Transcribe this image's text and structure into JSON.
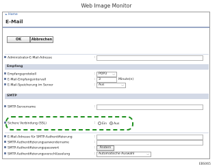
{
  "window": {
    "title": "Web Image Monitor"
  },
  "breadcrumb": {
    "arrow": "►",
    "home": "Home"
  },
  "page": {
    "title": "E-Mail"
  },
  "toolbar": {
    "ok_label": "OK",
    "cancel_label": "Abbrechen"
  },
  "fields": {
    "admin_email": {
      "label": "Administrator-E-Mail-Adresse",
      "value": ""
    },
    "reception_section": "Empfang",
    "protocol": {
      "label": "Empfangsprotokoll",
      "value": "POP3"
    },
    "interval": {
      "label": "E-Mail-Empfangsintervall",
      "value": "3",
      "unit": "Minute(n)"
    },
    "storage": {
      "label": "E-Mail-Speicherung im Server",
      "value": "Aus"
    },
    "smtp_section": "SMTP",
    "smtp_server": {
      "label": "SMTP-Servername",
      "value": ""
    },
    "ssl": {
      "label": "Sichere Verbindung (SSL)",
      "on_label": "Ein",
      "off_label": "Aus",
      "selected": "Aus"
    },
    "auth_email": {
      "label": "E-Mail-Adresse für SMTP-Authentifizierung",
      "value": ""
    },
    "auth_user": {
      "label": "SMTP-Authentifizierungsanwendername",
      "value": ""
    },
    "auth_password": {
      "label": "SMTP-Authentifizierungspasswort",
      "button": "Ändern"
    },
    "auth_encryption": {
      "label": "SMTP-Authentifizierungsverschlüsselung",
      "value": "Automatische Auswahl"
    }
  },
  "footer": {
    "code": "EBS065"
  },
  "colors": {
    "section_bg": "#d3d9e6",
    "highlight": "#1c8f1c",
    "link": "#1a4fa0"
  },
  "icons": {
    "select": "chevron-down-icon",
    "bullet": "square-bullet-icon"
  }
}
